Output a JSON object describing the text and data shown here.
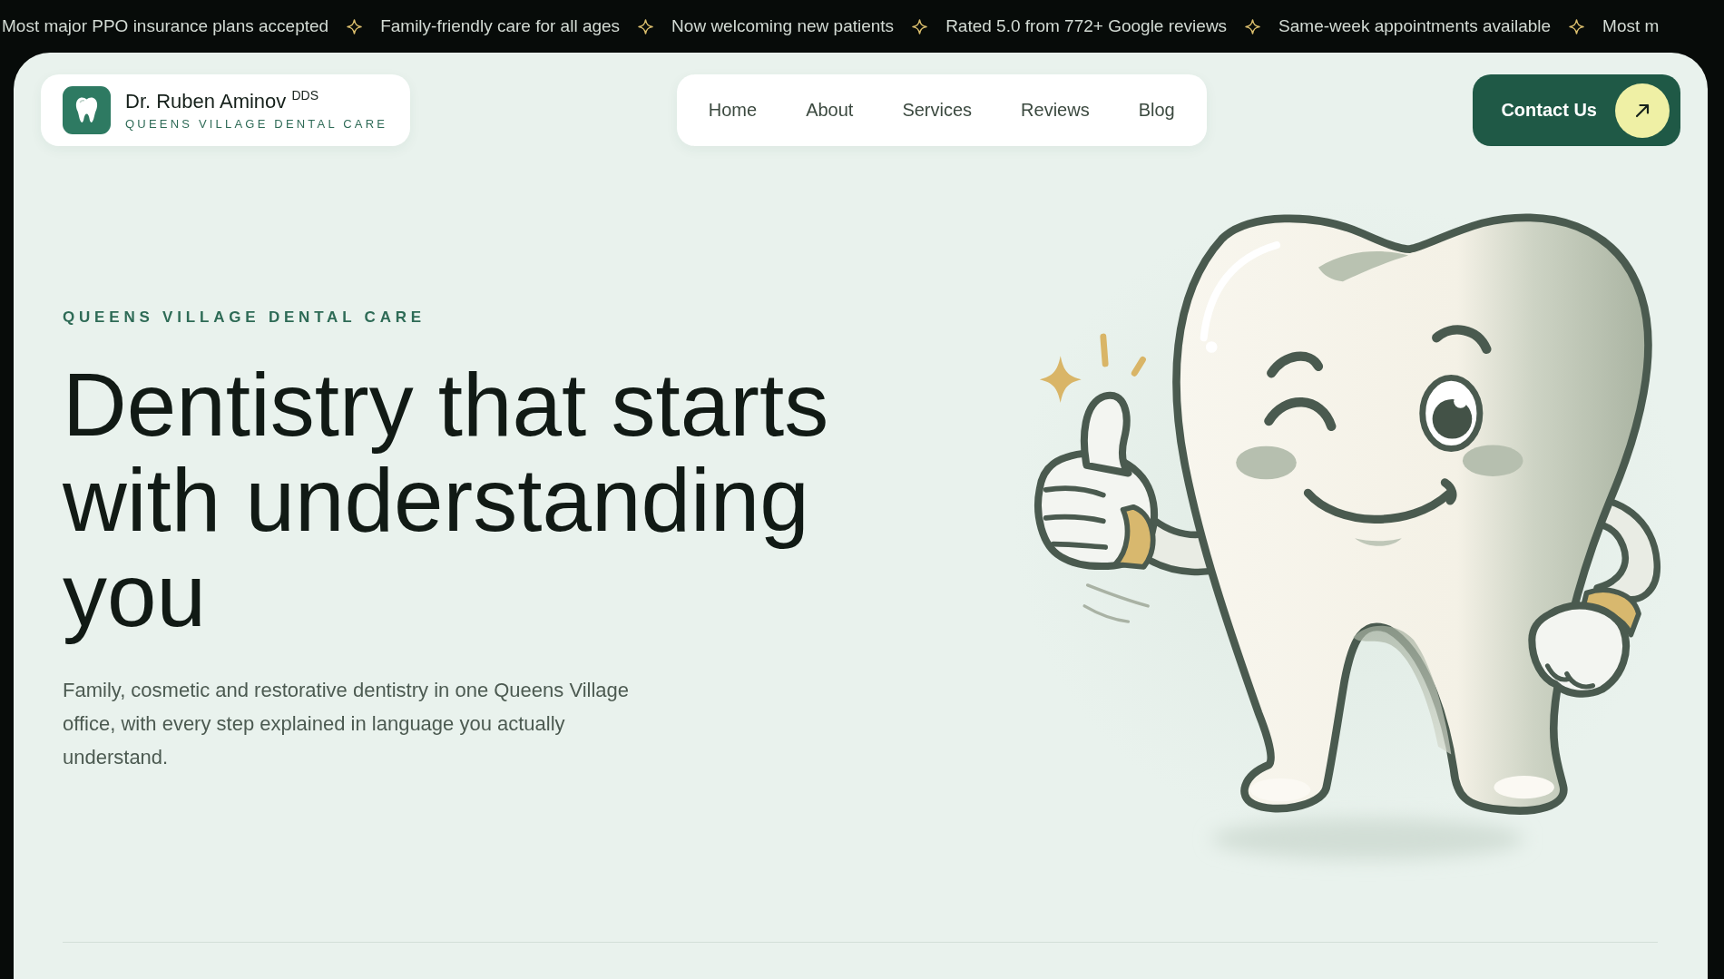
{
  "announcement_bar": {
    "items": [
      "Most major PPO insurance plans accepted",
      "Family-friendly care for all ages",
      "Now welcoming new patients",
      "Rated 5.0 from 772+ Google reviews",
      "Same-week appointments available",
      "Most m"
    ]
  },
  "header": {
    "logo": {
      "name": "Dr. Ruben Aminov $^{DDS}$",
      "tagline": "QUEENS VILLAGE DENTAL CARE"
    },
    "nav": [
      "Home",
      "About",
      "Services",
      "Reviews",
      "Blog"
    ],
    "cta": {
      "label": "Contact Us"
    }
  },
  "hero": {
    "eyebrow": "QUEENS VILLAGE DENTAL CARE",
    "headline": "Dentistry that starts with understanding you",
    "intro": "Family, cosmetic and restorative dentistry in one Queens Village office, with every step explained in language you actually understand."
  }
}
